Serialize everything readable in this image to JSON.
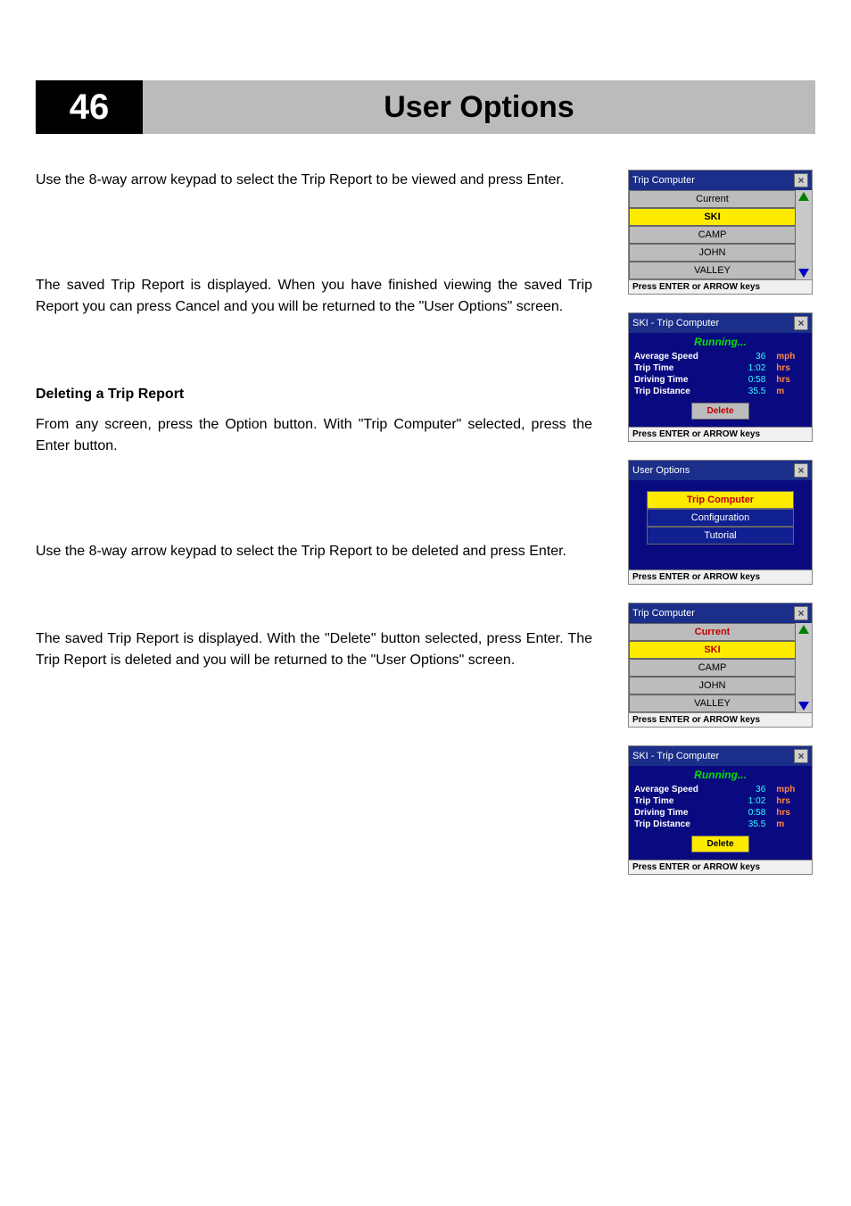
{
  "header": {
    "page_number": "46",
    "title": "User Options"
  },
  "paragraphs": {
    "p1": "Use the 8-way arrow keypad to select the Trip Report to be viewed and press Enter.",
    "p2": "The saved Trip Report is displayed. When you have finished viewing the saved Trip Report you can press Cancel and you will be returned to the \"User Options\" screen.",
    "heading": "Deleting a Trip Report",
    "p3": "From any screen, press the Option button. With \"Trip Computer\" selected, press the Enter button.",
    "p4": "Use the 8-way arrow keypad to select the Trip Report to be deleted and press Enter.",
    "p5": "The saved Trip Report is displayed. With the \"Delete\" button selected, press Enter. The Trip Report is deleted and you will be returned to the \"User Options\" screen."
  },
  "foot_text": "Press ENTER or ARROW keys",
  "trip_list": {
    "title": "Trip Computer",
    "items": [
      "Current",
      "SKI",
      "CAMP",
      "JOHN",
      "VALLEY"
    ],
    "selected_index": 1
  },
  "trip_detail": {
    "title": "SKI - Trip Computer",
    "status": "Running...",
    "rows": [
      {
        "label": "Average Speed",
        "value": "36",
        "unit": "mph"
      },
      {
        "label": "Trip Time",
        "value": "1:02",
        "unit": "hrs"
      },
      {
        "label": "Driving Time",
        "value": "0:58",
        "unit": "hrs"
      },
      {
        "label": "Trip Distance",
        "value": "35.5",
        "unit": "m"
      }
    ],
    "delete_label": "Delete"
  },
  "user_options": {
    "title": "User Options",
    "items": [
      "Trip Computer",
      "Configuration",
      "Tutorial"
    ],
    "selected_index": 0
  }
}
